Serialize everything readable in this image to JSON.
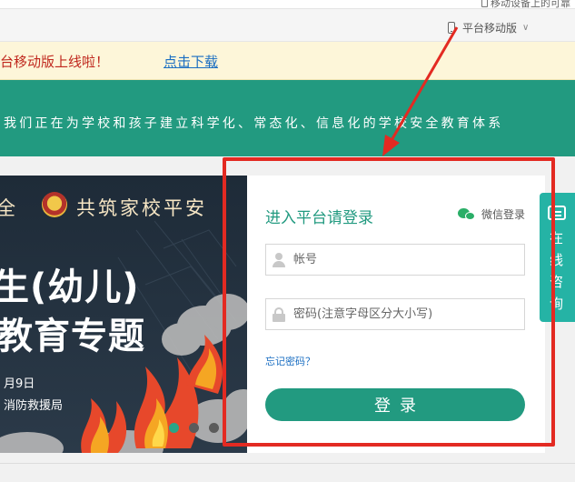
{
  "header": {
    "top_cut_text": "移动设备上的可靠",
    "mobile_link_label": "平台移动版",
    "mobile_link_chevron": "∨"
  },
  "notice": {
    "message": "台移动版上线啦！",
    "download_label": "点击下载"
  },
  "band": {
    "slogan": "我们正在为学校和孩子建立科学化、常态化、信息化的学校安全教育体系"
  },
  "banner": {
    "line1_left": "全",
    "line1_right": "共筑家校平安",
    "title_line1": "生(幼儿)",
    "title_line2": "教育专题",
    "date": "月9日",
    "organization": "消防救援局",
    "slide_count": 3,
    "active_slide": 1
  },
  "login": {
    "title": "进入平台请登录",
    "wechat_label": "微信登录",
    "username_placeholder": "帐号",
    "password_placeholder": "密码(注意字母区分大小写)",
    "forgot_label": "忘记密码？",
    "submit_label": "登录"
  },
  "consult": {
    "label": "在线咨询"
  },
  "colors": {
    "brand_green": "#229a80",
    "annotation_red": "#e32a22",
    "link_blue": "#1a6ec2",
    "notice_red": "#c0281e",
    "consult_teal": "#25b3a5"
  }
}
